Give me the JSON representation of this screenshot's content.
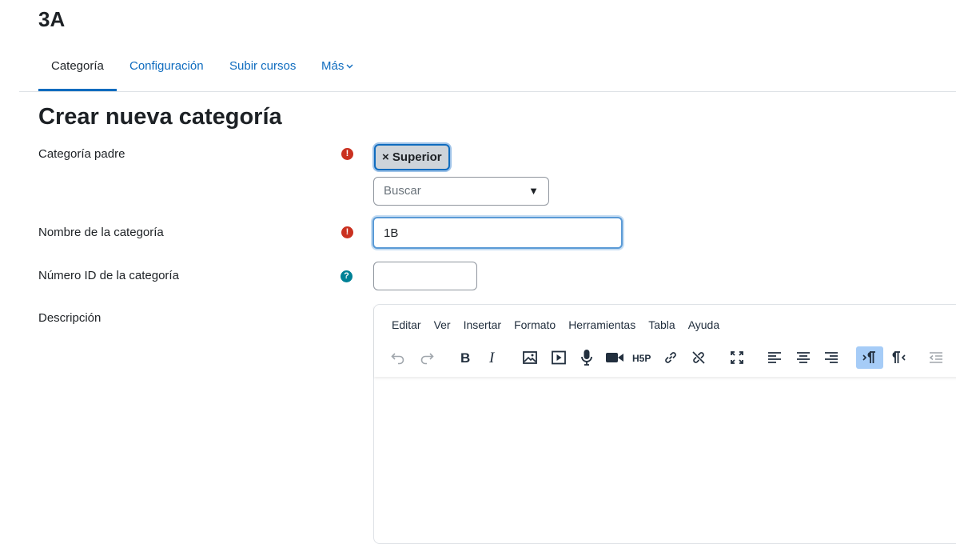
{
  "page": {
    "title": "3A"
  },
  "nav": {
    "tabs": [
      {
        "label": "Categoría",
        "active": true
      },
      {
        "label": "Configuración"
      },
      {
        "label": "Subir cursos"
      },
      {
        "label": "Más"
      }
    ]
  },
  "form": {
    "title": "Crear nueva categoría",
    "parent": {
      "label": "Categoría padre",
      "chip": "× Superior",
      "search_placeholder": "Buscar",
      "arrow": "▼"
    },
    "name": {
      "label": "Nombre de la categoría",
      "value": "1B"
    },
    "idnumber": {
      "label": "Número ID de la categoría",
      "value": ""
    },
    "description": {
      "label": "Descripción"
    },
    "icons": {
      "required": "!",
      "help": "?"
    }
  },
  "editor": {
    "menu": [
      "Editar",
      "Ver",
      "Insertar",
      "Formato",
      "Herramientas",
      "Tabla",
      "Ayuda"
    ],
    "toolbar_icons": [
      "undo-icon",
      "redo-icon",
      "bold-icon",
      "italic-icon",
      "image-icon",
      "media-icon",
      "microphone-icon",
      "video-camera-icon",
      "h5p-icon",
      "link-icon",
      "unlink-icon",
      "fullscreen-icon",
      "align-left-icon",
      "align-center-icon",
      "align-right-icon",
      "ltr-icon",
      "rtl-icon",
      "outdent-icon"
    ],
    "h5p_label": "H5P"
  },
  "colors": {
    "link": "#0f6cbf",
    "required": "#ca3120",
    "help": "#008196",
    "chip_bg": "#ced4da",
    "active_toolbar": "#a6ccf7"
  }
}
